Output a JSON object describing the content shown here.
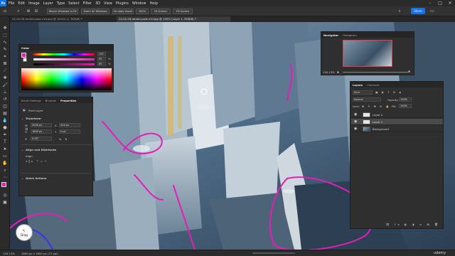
{
  "app": {
    "logo": "Ps"
  },
  "menu": [
    "File",
    "Edit",
    "Image",
    "Layer",
    "Type",
    "Select",
    "Filter",
    "3D",
    "View",
    "Plugins",
    "Window",
    "Help"
  ],
  "window_controls": [
    "minimize-icon",
    "maximize-icon",
    "close-icon"
  ],
  "options": {
    "resize": "Resize Windows to Fit",
    "zoom_all": "Zoom All Windows",
    "scrubby": "Scrubby Zoom",
    "zoom_pct": "100%",
    "fit": "Fit Screen",
    "fill": "Fill Screen",
    "share": "Share"
  },
  "tabs": [
    {
      "label": "24-02-26-render-post-v1d.psd @ 18.4% (1, RGB/8) *",
      "active": false
    },
    {
      "label": "24-02-26-render-post-v1d.jpg @ 100% (Layer 1, RGB/8) *",
      "active": true
    }
  ],
  "color_panel": {
    "title": "Color",
    "values": [
      "155",
      "95",
      "65"
    ],
    "units": [
      "",
      "%",
      "%"
    ],
    "accent_color": "#e21fb4"
  },
  "properties_panel": {
    "tabs": [
      "Brush Settings",
      "Brushes",
      "Properties"
    ],
    "active_tab": "Properties",
    "kind": "Pixel Layer",
    "transform_title": "Transform",
    "w": "2026 px",
    "h": "1800 px",
    "x": "424 px",
    "y": "0 px",
    "angle": "0.00°",
    "align_title": "Align and Distribute",
    "align_sub": "Align:",
    "quick_title": "Quick Actions"
  },
  "navigator_panel": {
    "tabs": [
      "Navigator",
      "Histogram"
    ],
    "zoom": "130.13%"
  },
  "layers_panel": {
    "tabs": [
      "Layers",
      "Channels"
    ],
    "kind_filter": "Kind",
    "blend": "Normal",
    "opacity_label": "Opacity:",
    "opacity": "100%",
    "lock_label": "Lock:",
    "fill_label": "Fill:",
    "fill": "100%",
    "layers": [
      {
        "name": "Layer 2",
        "selected": false
      },
      {
        "name": "Layer 1",
        "selected": true
      },
      {
        "name": "Background",
        "selected": false
      }
    ]
  },
  "status": {
    "zoom": "130.13%",
    "doc": "1800 px x 1800 px (72 ppi)"
  },
  "drag_badge": "Drag",
  "watermark": "udemy"
}
